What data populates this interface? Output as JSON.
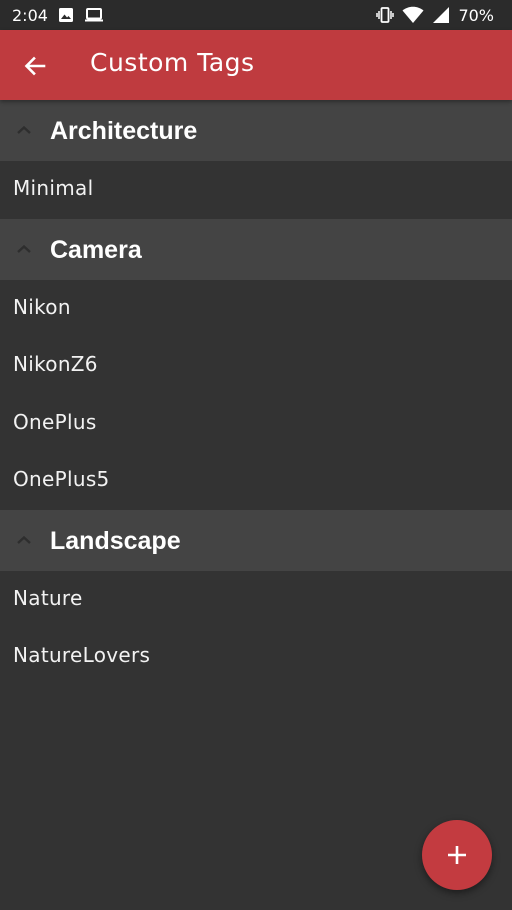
{
  "status_bar": {
    "time": "2:04",
    "battery": "70%",
    "left_icons": [
      "image-icon",
      "laptop-icon"
    ],
    "right_icons": [
      "vibrate-icon",
      "wifi-icon",
      "signal-icon"
    ]
  },
  "app_bar": {
    "title": "Custom Tags",
    "back_icon": "arrow-left-icon",
    "color": "#bf3b3f"
  },
  "sections": [
    {
      "title": "Architecture",
      "items": [
        "Minimal"
      ]
    },
    {
      "title": "Camera",
      "items": [
        "Nikon",
        "NikonZ6",
        "OnePlus",
        "OnePlus5"
      ]
    },
    {
      "title": "Landscape",
      "items": [
        "Nature",
        "NatureLovers"
      ]
    }
  ],
  "fab": {
    "icon": "plus-icon",
    "color": "#c33b40"
  }
}
